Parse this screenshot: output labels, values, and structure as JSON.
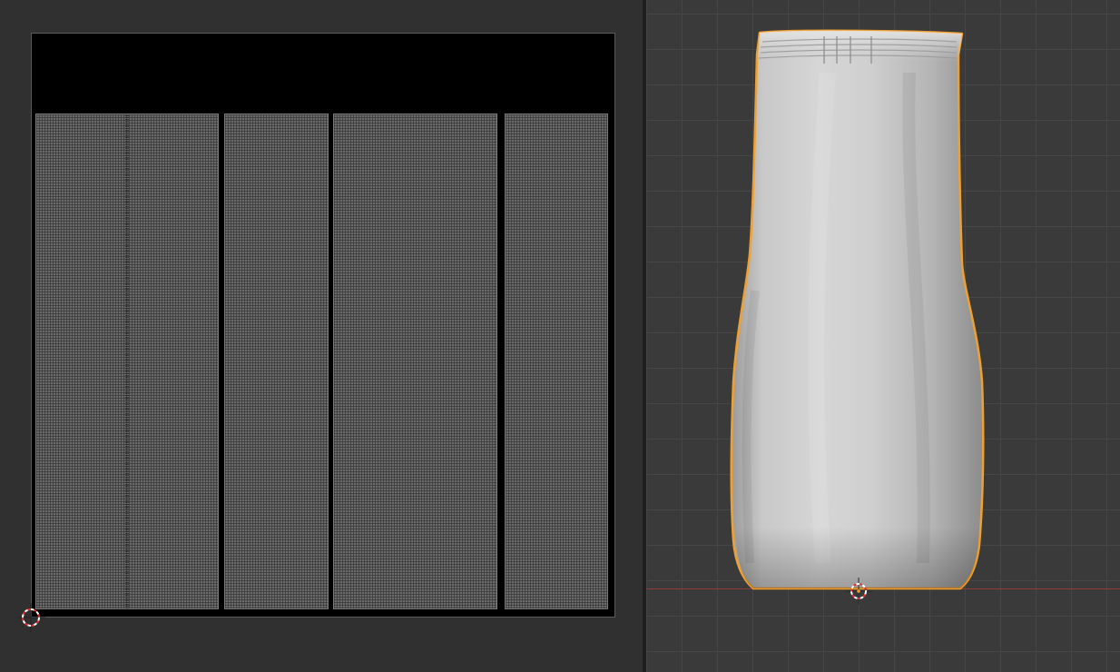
{
  "uv_editor": {
    "island_count": 4,
    "cursor_icon": "2d-cursor-icon"
  },
  "viewport_3d": {
    "object": {
      "state": "selected",
      "outline_color": "#f0a030"
    },
    "colors": {
      "background": "#3a3a3a",
      "grid_line": "#464646",
      "x_axis": "#8a3b3b"
    },
    "cursor_icon": "3d-cursor-icon"
  }
}
